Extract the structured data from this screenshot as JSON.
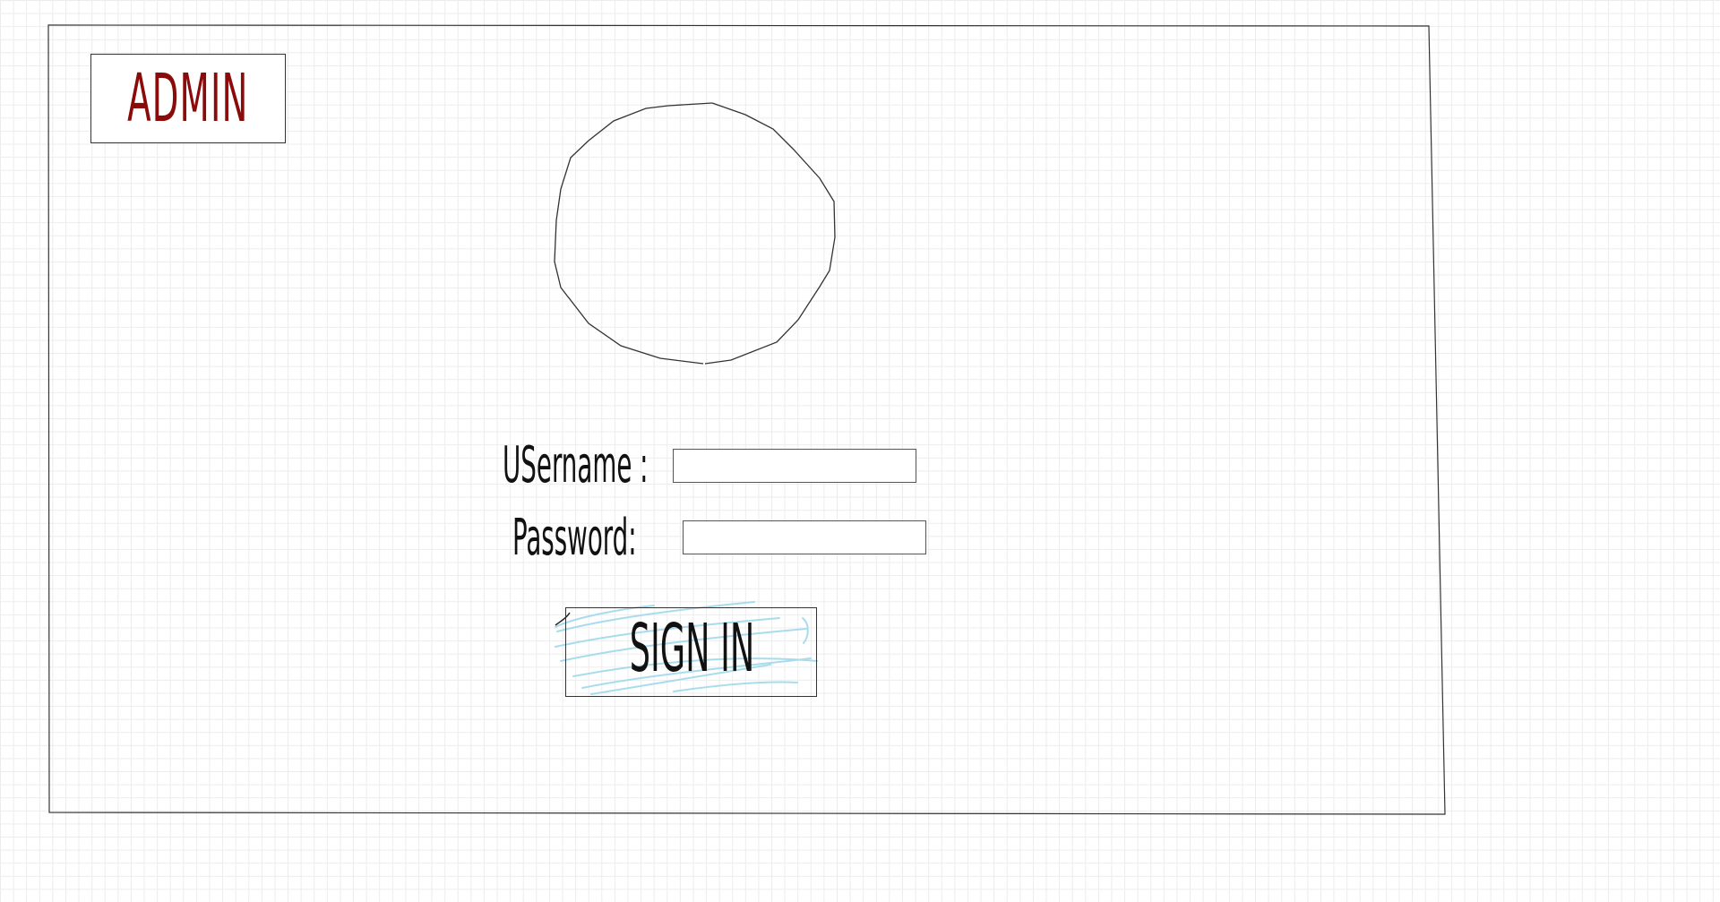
{
  "brand": {
    "label": "ADMIN",
    "color": "#8b0a0a"
  },
  "avatar": {
    "icon": "avatar-placeholder-circle"
  },
  "login_form": {
    "username_label": "USername :",
    "password_label": "Password:",
    "username_value": "",
    "password_value": "",
    "sign_in_label": "SIGN IN"
  },
  "colors": {
    "button_scribble": "#a8dcec",
    "frame_stroke": "#333333"
  }
}
